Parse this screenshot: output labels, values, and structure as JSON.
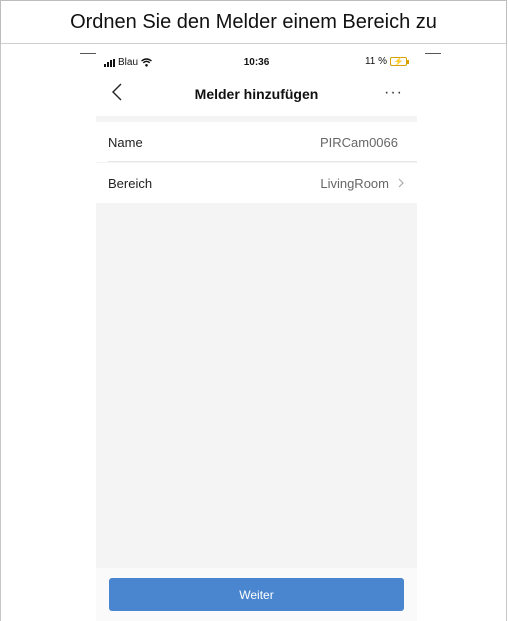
{
  "document": {
    "heading": "Ordnen Sie den Melder einem Bereich zu"
  },
  "status_bar": {
    "carrier": "Blau",
    "time": "10:36",
    "battery_percent": "11 %",
    "icons": [
      "signal-icon",
      "wifi-icon",
      "battery-charging-icon"
    ]
  },
  "nav": {
    "title": "Melder hinzufügen",
    "back_icon": "chevron-left-icon",
    "more_label": "···"
  },
  "form": {
    "rows": [
      {
        "label": "Name",
        "value": "PIRCam0066"
      },
      {
        "label": "Bereich",
        "value": "LivingRoom"
      }
    ]
  },
  "actions": {
    "next_label": "Weiter"
  },
  "colors": {
    "primary_button": "#4a86cf",
    "battery": "#d8a000",
    "background": "#f4f4f4"
  }
}
